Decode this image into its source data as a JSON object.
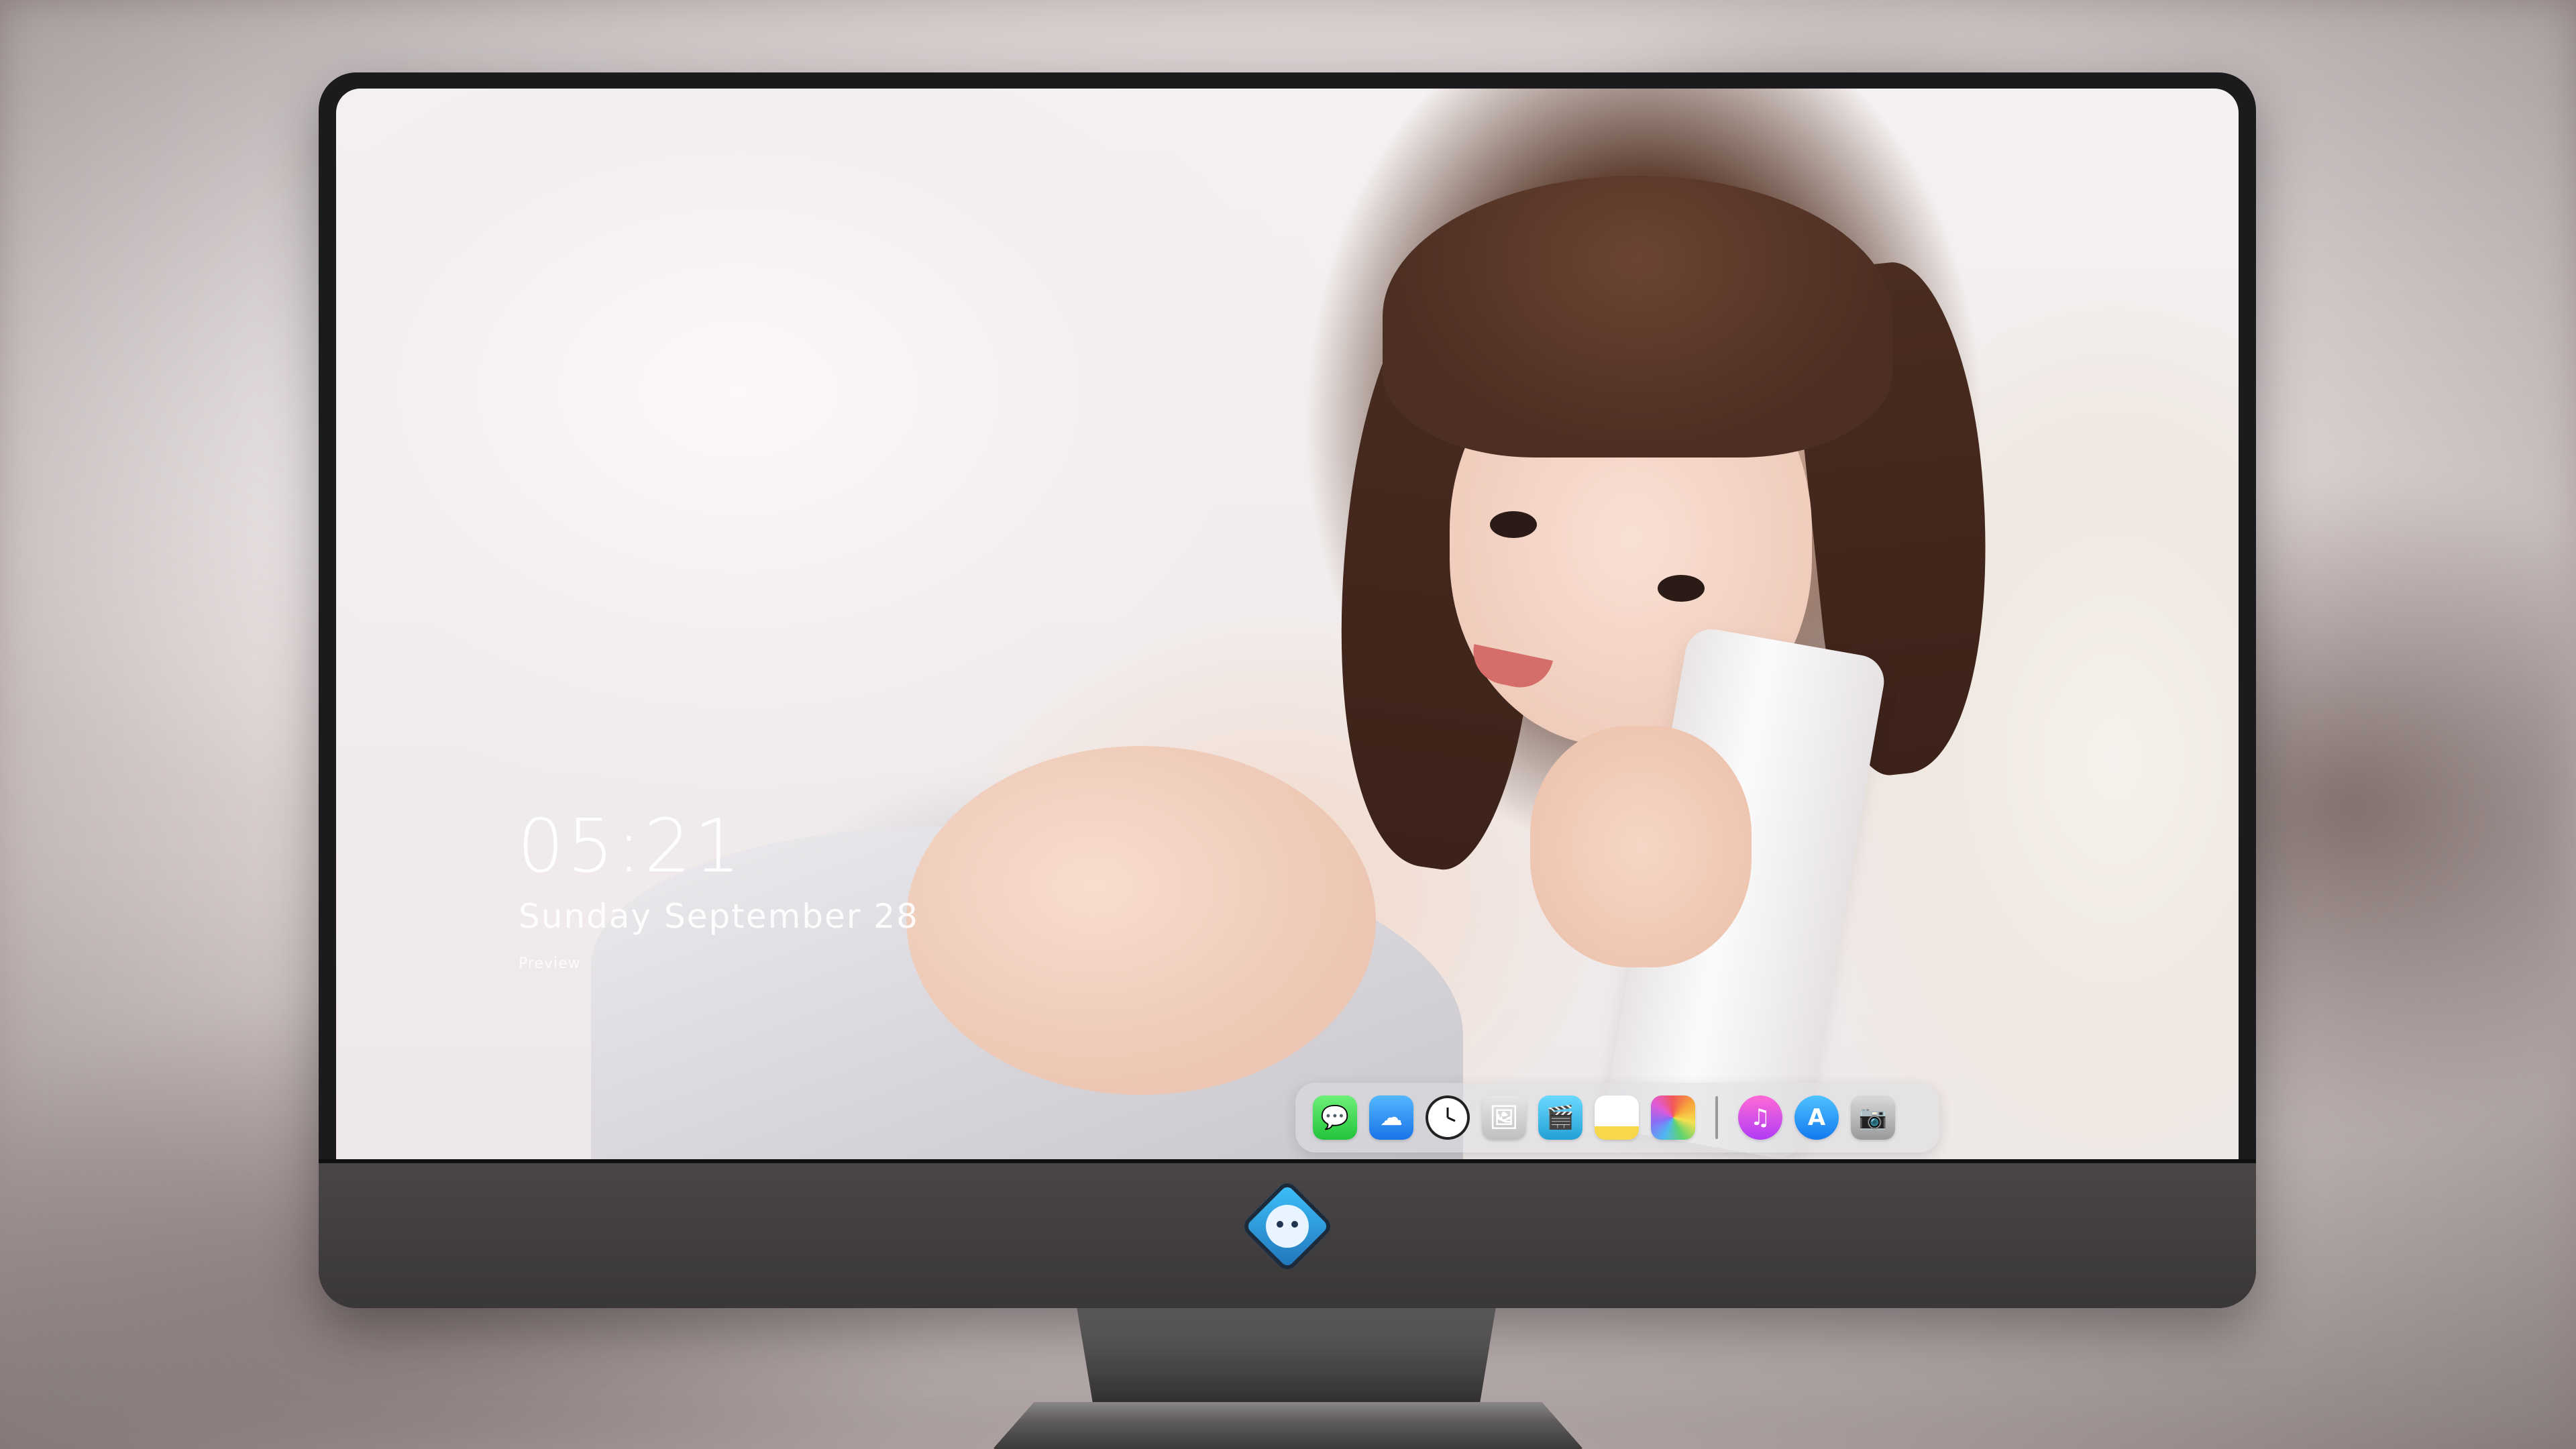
{
  "lock_screen": {
    "time": "05:21",
    "date": "Sunday  September  28",
    "preview_text": "Preview"
  },
  "dock": {
    "apps": [
      {
        "name": "Messages",
        "glyph": "💬",
        "icon": "messages-icon"
      },
      {
        "name": "Weather",
        "glyph": "☁",
        "icon": "weather-icon"
      },
      {
        "name": "Clock",
        "glyph": "🕐",
        "icon": "clock-icon"
      },
      {
        "name": "Preview",
        "glyph": "🖼",
        "icon": "preview-icon"
      },
      {
        "name": "Final Cut Pro",
        "glyph": "🎬",
        "icon": "clapper-icon"
      },
      {
        "name": "Notes",
        "glyph": "",
        "icon": "notes-icon"
      },
      {
        "name": "Photos",
        "glyph": "",
        "icon": "photos-icon"
      },
      {
        "name": "Music",
        "glyph": "♫",
        "icon": "music-icon"
      },
      {
        "name": "App Store",
        "glyph": "A",
        "icon": "app-store-icon"
      },
      {
        "name": "Camera",
        "glyph": "📷",
        "icon": "camera-icon"
      }
    ]
  },
  "colors": {
    "monitor_bezel": "#1b1b1d",
    "monitor_chin": "#3f3c3e",
    "dock_background": "rgba(220,220,224,0.55)",
    "logo_accent": "#3fc6ff"
  }
}
